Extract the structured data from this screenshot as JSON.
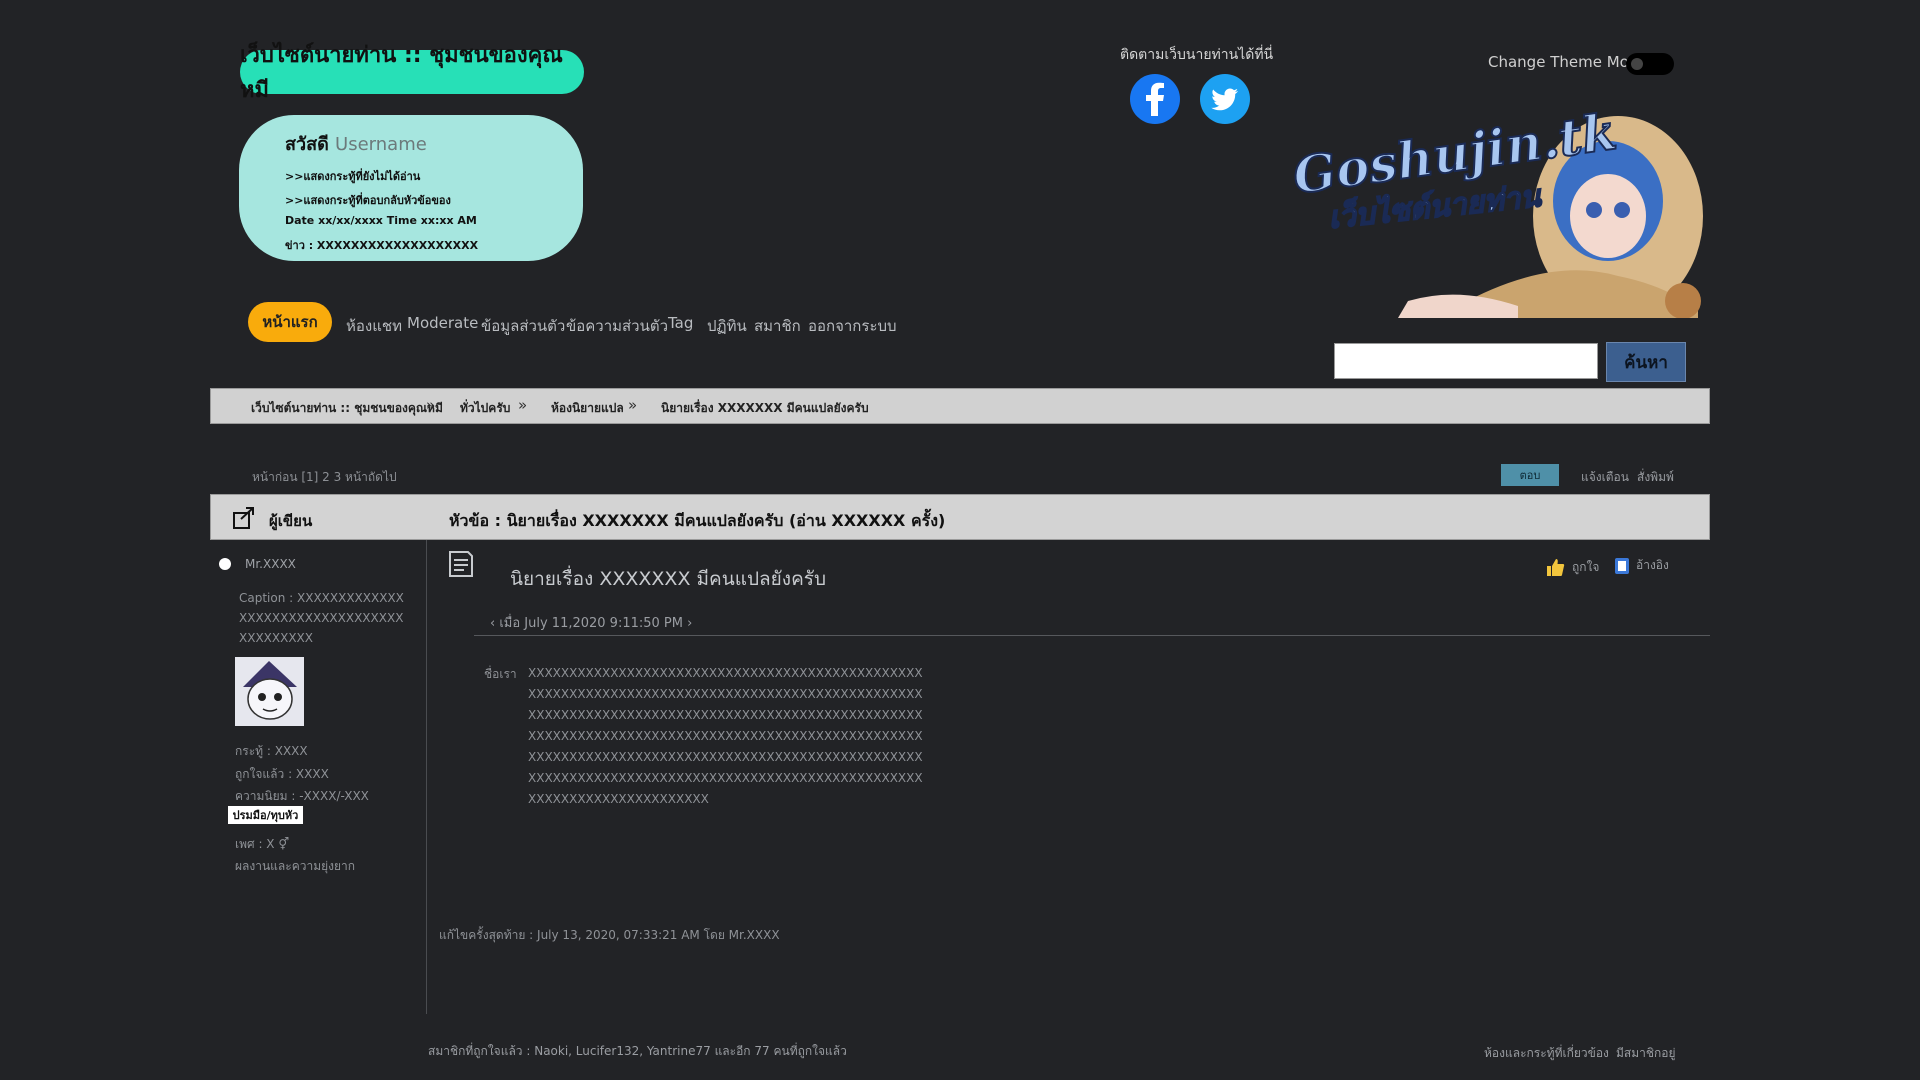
{
  "header": {
    "site_title": "เว็บไซต์นายท่าน :: ชุมชนของคุณหมี",
    "greeting_prefix": "สวัสดี ",
    "greeting_username": "Username",
    "user_lines": [
      ">>แสดงกระทู้ที่ยังไม่ได้อ่าน",
      ">>แสดงกระทู้ที่ตอบกลับหัวข้อของ",
      "Date xx/xx/xxxx Time xx:xx AM",
      "ข่าว : XXXXXXXXXXXXXXXXXXX"
    ],
    "follow_label": "ติดตามเว็บนายท่านได้ที่นี่",
    "theme_label": "Change Theme Mode",
    "logo_line1": "Goshujin.tk",
    "logo_line2": "เว็บไซต์นายท่าน",
    "search_placeholder": "",
    "search_button": "ค้นหา"
  },
  "nav": {
    "home": "หน้าแรก",
    "items": [
      "ห้องแชท",
      "Moderate",
      "ข้อมูลส่วนตัว",
      "ข้อความส่วนตัว",
      "Tag",
      "ปฏิทิน",
      "สมาชิก",
      "ออกจากระบบ"
    ]
  },
  "breadcrumb": {
    "items": [
      "เว็บไซต์นายท่าน :: ชุมชนของคุณหมี",
      "ทั่วไปครับ",
      "ห้องนิยายแปล",
      "นิยายเรื่อง XXXXXXX มีคนแปลยังครับ"
    ],
    "separator": "»"
  },
  "pager": {
    "text": "หน้าก่อน [1] 2 3 หน้าถัดไป",
    "reply": "ตอบ",
    "links": [
      "แจ้งเตือน",
      "สั่งพิมพ์"
    ]
  },
  "topic": {
    "author_label": "ผู้เขียน",
    "title": "หัวข้อ : นิยายเรื่อง XXXXXXX มีคนแปลยังครับ (อ่าน XXXXXX ครั้ง)"
  },
  "author": {
    "name": "Mr.XXXX",
    "caption": "Caption : XXXXXXXXXXXXXXXXXXXXXXXXXXXXXXXXXXXXXXXXXX",
    "stats": [
      "กระทู้ : XXXX",
      "ถูกใจแล้ว : XXXX",
      "ความนิยม : -XXXX/-XXX"
    ],
    "badge": "ปรมมือ/ทุบหัว",
    "gender": "เพศ : X ⚥",
    "profile_link": "ผลงานและความยุ่งยาก"
  },
  "post": {
    "title": "นิยายเรื่อง XXXXXXX มีคนแปลยังครับ",
    "date": "‹ เมื่อ July 11,2020 9:11:50 PM ›",
    "quote_label": "ชื่อเรา",
    "body": "XXXXXXXXXXXXXXXXXXXXXXXXXXXXXXXXXXXXXXXXXXXXXXXXXXXXXXXXXXXXXXXXXXXXXXXXXXXXXXXXXXXXXXXXXXXXXXXXXXXXXXXXXXXXXXXXXXXXXXXXXXXXXXXXXXXXXXXXXXXXXXXXXXXXXXXXXXXXXXXXXXXXXXXXXXXXXXXXXXXXXXXXXXXXXXXXXXXXXXXXXXXXXXXXXXXXXXXXXXXXXXXXXXXXXXXXXXXXXXXXXXXXXXXXXXXXXXXXXXXXXXXXXXXXXXXXXXXXXXXXXXXXXXXXXXXXXXXXXXXXXXXXXXXXXX",
    "edited": "แก้ไขครั้งสุดท้าย : July 13, 2020, 07:33:21 AM โดย Mr.XXXX",
    "actions": [
      "ถูกใจ",
      "อ้างอิง"
    ]
  },
  "footer": {
    "online": "สมาชิกที่ถูกใจแล้ว : Naoki, Lucifer132, Yantrine77 และอีก 77 คนที่ถูกใจแล้ว",
    "links": [
      "ห้องและกระทู้ที่เกี่ยวข้อง",
      "มีสมาชิกอยู่"
    ]
  },
  "colors": {
    "accent_teal": "#27e0b7",
    "home_orange": "#f9ab0c",
    "background": "#222326"
  }
}
